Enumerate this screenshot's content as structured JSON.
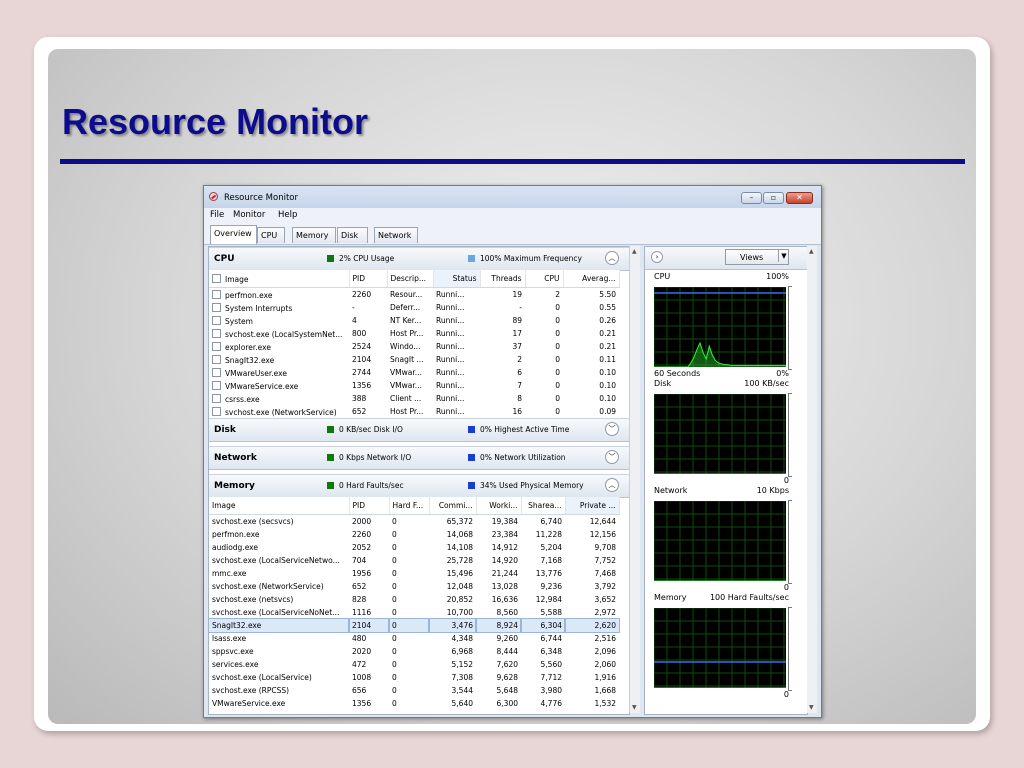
{
  "slide": {
    "title": "Resource Monitor"
  },
  "window": {
    "title": "Resource Monitor",
    "menu": [
      "File",
      "Monitor",
      "Help"
    ],
    "tabs": [
      "Overview",
      "CPU",
      "Memory",
      "Disk",
      "Network"
    ],
    "active_tab": "Overview"
  },
  "cpu": {
    "title": "CPU",
    "usage": "2% CPU Usage",
    "frequency": "100% Maximum Frequency",
    "columns": [
      "Image",
      "PID",
      "Descrip...",
      "Status",
      "Threads",
      "CPU",
      "Averag..."
    ],
    "rows": [
      [
        "perfmon.exe",
        "2260",
        "Resour...",
        "Runni...",
        "19",
        "2",
        "5.50"
      ],
      [
        "System Interrupts",
        "-",
        "Deferr...",
        "Runni...",
        "-",
        "0",
        "0.55"
      ],
      [
        "System",
        "4",
        "NT Ker...",
        "Runni...",
        "89",
        "0",
        "0.26"
      ],
      [
        "svchost.exe (LocalSystemNet...",
        "800",
        "Host Pr...",
        "Runni...",
        "17",
        "0",
        "0.21"
      ],
      [
        "explorer.exe",
        "2524",
        "Windo...",
        "Runni...",
        "37",
        "0",
        "0.21"
      ],
      [
        "SnagIt32.exe",
        "2104",
        "SnagIt ...",
        "Runni...",
        "2",
        "0",
        "0.11"
      ],
      [
        "VMwareUser.exe",
        "2744",
        "VMwar...",
        "Runni...",
        "6",
        "0",
        "0.10"
      ],
      [
        "VMwareService.exe",
        "1356",
        "VMwar...",
        "Runni...",
        "7",
        "0",
        "0.10"
      ],
      [
        "csrss.exe",
        "388",
        "Client ...",
        "Runni...",
        "8",
        "0",
        "0.10"
      ],
      [
        "svchost.exe (NetworkService)",
        "652",
        "Host Pr...",
        "Runni...",
        "16",
        "0",
        "0.09"
      ]
    ]
  },
  "disk": {
    "title": "Disk",
    "io": "0 KB/sec Disk I/O",
    "active": "0% Highest Active Time"
  },
  "network": {
    "title": "Network",
    "io": "0 Kbps Network I/O",
    "util": "0% Network Utilization"
  },
  "memory": {
    "title": "Memory",
    "faults": "0 Hard Faults/sec",
    "used": "34% Used Physical Memory",
    "columns": [
      "Image",
      "PID",
      "Hard F...",
      "Commi...",
      "Worki...",
      "Sharea...",
      "Private ..."
    ],
    "rows": [
      [
        "svchost.exe (secsvcs)",
        "2000",
        "0",
        "65,372",
        "19,384",
        "6,740",
        "12,644"
      ],
      [
        "perfmon.exe",
        "2260",
        "0",
        "14,068",
        "23,384",
        "11,228",
        "12,156"
      ],
      [
        "audiodg.exe",
        "2052",
        "0",
        "14,108",
        "14,912",
        "5,204",
        "9,708"
      ],
      [
        "svchost.exe (LocalServiceNetwo...",
        "704",
        "0",
        "25,728",
        "14,920",
        "7,168",
        "7,752"
      ],
      [
        "mmc.exe",
        "1956",
        "0",
        "15,496",
        "21,244",
        "13,776",
        "7,468"
      ],
      [
        "svchost.exe (NetworkService)",
        "652",
        "0",
        "12,048",
        "13,028",
        "9,236",
        "3,792"
      ],
      [
        "svchost.exe (netsvcs)",
        "828",
        "0",
        "20,852",
        "16,636",
        "12,984",
        "3,652"
      ],
      [
        "svchost.exe (LocalServiceNoNet...",
        "1116",
        "0",
        "10,700",
        "8,560",
        "5,588",
        "2,972"
      ],
      [
        "SnagIt32.exe",
        "2104",
        "0",
        "3,476",
        "8,924",
        "6,304",
        "2,620"
      ],
      [
        "lsass.exe",
        "480",
        "0",
        "4,348",
        "9,260",
        "6,744",
        "2,516"
      ],
      [
        "sppsvc.exe",
        "2020",
        "0",
        "6,968",
        "8,444",
        "6,348",
        "2,096"
      ],
      [
        "services.exe",
        "472",
        "0",
        "5,152",
        "7,620",
        "5,560",
        "2,060"
      ],
      [
        "svchost.exe (LocalService)",
        "1008",
        "0",
        "7,308",
        "9,628",
        "7,712",
        "1,916"
      ],
      [
        "svchost.exe (RPCSS)",
        "656",
        "0",
        "3,544",
        "5,648",
        "3,980",
        "1,668"
      ],
      [
        "VMwareService.exe",
        "1356",
        "0",
        "5,640",
        "6,300",
        "4,776",
        "1,532"
      ]
    ],
    "selected_row": 8
  },
  "right_panel": {
    "views_label": "Views",
    "graphs": [
      {
        "name": "CPU",
        "max": "100%",
        "footer_left": "60 Seconds",
        "footer_right": "0%",
        "values": [
          0,
          0,
          0,
          0,
          0,
          0,
          0,
          0,
          0,
          0,
          0,
          0,
          5,
          12,
          22,
          30,
          18,
          10,
          26,
          15,
          8,
          5,
          4,
          3,
          3,
          2,
          2,
          2,
          2,
          2,
          2,
          2,
          2,
          2,
          2,
          2,
          2,
          2,
          2,
          2,
          2,
          2,
          2,
          2
        ]
      },
      {
        "name": "Disk",
        "max": "100 KB/sec",
        "footer_right": "0",
        "values": [
          0,
          0,
          0,
          0,
          0,
          0,
          0,
          0,
          0,
          0,
          0,
          0,
          0,
          0,
          0,
          0,
          0,
          0,
          0,
          0,
          0,
          0,
          0,
          0,
          0,
          0,
          0,
          0,
          0,
          0,
          0,
          0,
          0,
          0,
          0,
          0,
          0,
          0,
          0,
          0,
          0,
          0,
          0,
          0,
          0,
          0,
          0,
          0,
          0,
          0,
          0,
          0,
          0,
          0,
          0,
          0,
          0,
          0,
          0,
          0,
          0,
          0,
          0,
          0,
          0,
          0,
          0,
          0,
          0,
          0,
          0,
          0,
          0,
          0,
          0,
          0,
          0,
          0,
          0,
          0,
          0,
          0,
          0,
          0,
          0,
          0,
          0,
          0,
          0,
          0,
          0,
          0,
          0,
          0,
          0,
          0,
          0,
          0,
          0,
          0,
          0,
          0,
          0,
          0,
          0,
          0,
          0,
          0,
          0,
          0,
          0,
          0,
          0,
          0,
          0,
          0,
          0,
          0,
          0,
          0,
          0,
          0,
          0,
          0,
          0,
          0,
          0,
          0,
          0,
          0
        ]
      },
      {
        "name": "Network",
        "max": "10 Kbps",
        "footer_right": "0",
        "values": [
          0,
          0,
          0,
          0,
          0,
          0,
          0,
          0,
          0,
          0,
          0,
          0,
          0,
          0,
          0,
          0,
          0,
          0,
          0,
          0,
          0,
          0,
          0,
          0,
          0,
          0,
          0,
          0,
          0,
          0,
          0,
          0,
          0,
          0,
          0,
          0,
          0,
          0,
          0,
          0,
          0,
          0,
          0,
          0,
          0,
          0,
          0,
          0,
          0,
          0,
          0,
          0,
          0,
          0,
          0,
          0,
          0,
          0,
          0,
          0,
          0,
          0,
          0,
          0,
          0,
          0,
          0,
          0,
          0,
          0,
          0,
          0,
          0,
          0,
          0,
          0,
          0,
          0,
          0,
          0,
          0,
          0,
          0,
          0,
          0,
          0,
          0,
          0,
          0,
          0,
          0,
          0,
          0,
          0,
          0,
          0,
          0,
          0,
          0,
          0,
          0,
          0,
          0,
          0,
          0,
          0,
          0,
          0,
          0,
          0,
          0,
          0,
          0,
          0,
          0,
          0,
          0,
          0,
          0,
          0,
          0,
          0,
          0,
          0,
          0,
          0,
          0,
          0,
          0,
          0
        ]
      },
      {
        "name": "Memory",
        "max": "100 Hard Faults/sec",
        "footer_right": "0",
        "values": [
          0,
          0,
          0,
          0,
          0,
          0,
          0,
          0,
          0,
          0,
          0,
          0,
          0,
          0,
          0,
          0,
          0,
          0,
          0,
          0,
          0,
          0,
          0,
          0,
          0,
          0,
          0,
          0,
          0,
          0,
          0,
          0,
          0,
          0,
          0,
          0,
          0,
          0,
          0,
          0,
          0,
          0,
          0,
          0
        ]
      }
    ]
  },
  "colors": {
    "green": "#0a7a0a",
    "blue": "#1a3fd0",
    "freq": "#6aa7e0",
    "slide_title": "#0c0c8c"
  }
}
